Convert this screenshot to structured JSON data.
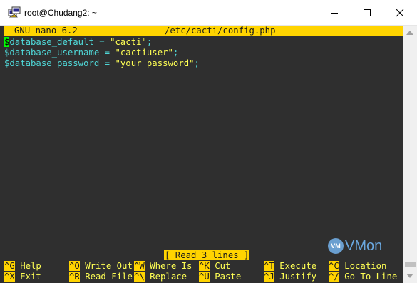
{
  "window": {
    "title": "root@Chudang2: ~"
  },
  "nano": {
    "version": "GNU nano 6.2",
    "filename": "/etc/cacti/config.php"
  },
  "code": [
    {
      "var_first_char": "$",
      "var_rest": "database_default",
      "op": " = ",
      "str": "\"cacti\"",
      "end": ";"
    },
    {
      "var_first_char": "$",
      "var_rest": "database_username",
      "op": " = ",
      "str": "\"cactiuser\"",
      "end": ";"
    },
    {
      "var_first_char": "$",
      "var_rest": "database_password",
      "op": " = ",
      "str": "\"your_password\"",
      "end": ";"
    }
  ],
  "status": "[ Read 3 lines ]",
  "shortcuts": {
    "row1": [
      {
        "key": "^G",
        "label": " Help"
      },
      {
        "key": "^O",
        "label": " Write Out"
      },
      {
        "key": "^W",
        "label": " Where Is"
      },
      {
        "key": "^K",
        "label": " Cut"
      },
      {
        "key": "^T",
        "label": " Execute"
      },
      {
        "key": "^C",
        "label": " Location"
      }
    ],
    "row2": [
      {
        "key": "^X",
        "label": " Exit"
      },
      {
        "key": "^R",
        "label": " Read File"
      },
      {
        "key": "^\\",
        "label": " Replace"
      },
      {
        "key": "^U",
        "label": " Paste"
      },
      {
        "key": "^J",
        "label": " Justify"
      },
      {
        "key": "^/",
        "label": " Go To Line"
      }
    ]
  },
  "watermark": {
    "badge": "VM",
    "text": "VMon"
  },
  "colors": {
    "terminal_bg": "#2f2f2f",
    "nano_accent": "#ffd400",
    "variable": "#4fd7d7",
    "string": "#ffff54",
    "cursor": "#00ff00"
  },
  "icons": [
    "putty-terminal-icon",
    "minimize-icon",
    "maximize-icon",
    "close-icon",
    "scroll-up-icon",
    "scroll-down-icon"
  ]
}
